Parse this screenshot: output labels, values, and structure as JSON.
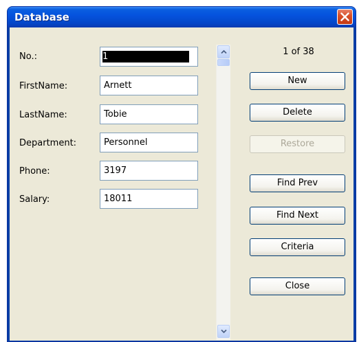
{
  "window": {
    "title": "Database",
    "close_icon": "close-icon"
  },
  "fields": [
    {
      "label": "No.:",
      "value": "1",
      "selected": true
    },
    {
      "label": "FirstName:",
      "value": "Arnett"
    },
    {
      "label": "LastName:",
      "value": "Tobie"
    },
    {
      "label": "Department:",
      "value": "Personnel"
    },
    {
      "label": "Phone:",
      "value": "3197"
    },
    {
      "label": "Salary:",
      "value": "18011"
    }
  ],
  "record_counter": "1 of 38",
  "buttons": {
    "new": "New",
    "delete": "Delete",
    "restore": "Restore",
    "find_prev": "Find Prev",
    "find_next": "Find Next",
    "criteria": "Criteria",
    "close": "Close"
  },
  "colors": {
    "titlebar": "#0553de",
    "close_button": "#d9512a",
    "dialog_background": "#ece9d8"
  }
}
